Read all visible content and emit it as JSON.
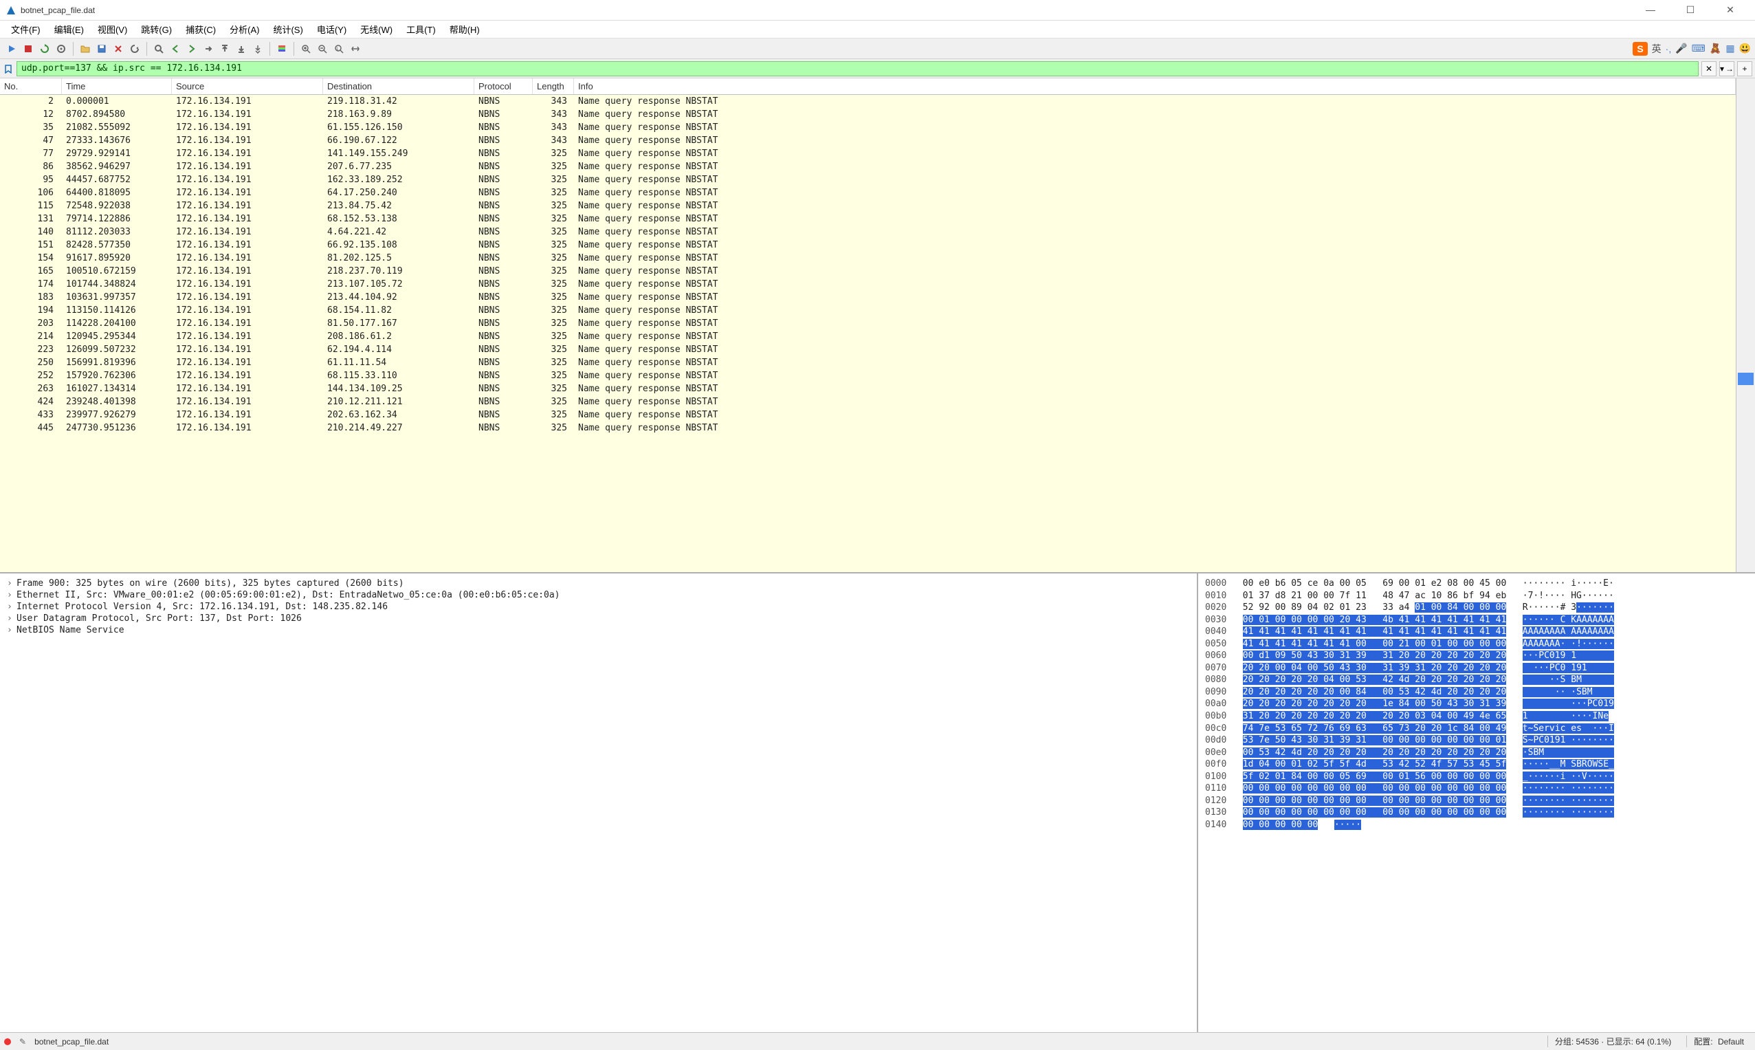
{
  "window": {
    "title": "botnet_pcap_file.dat",
    "min": "—",
    "max": "☐",
    "close": "✕"
  },
  "menu": {
    "file": "文件(F)",
    "edit": "编辑(E)",
    "view": "视图(V)",
    "go": "跳转(G)",
    "capture": "捕获(C)",
    "analyze": "分析(A)",
    "statistics": "统计(S)",
    "telephony": "电话(Y)",
    "wireless": "无线(W)",
    "tools": "工具(T)",
    "help": "帮助(H)"
  },
  "toolbar_icons": {
    "start": "▶",
    "stop": "■",
    "restart": "⟳",
    "options": "⚙",
    "open": "📂",
    "save": "💾",
    "close": "✖",
    "reload": "⟲",
    "find": "🔍",
    "back": "←",
    "fwd": "→",
    "jump": "↷",
    "goto_first": "⤒",
    "goto_last": "⤓",
    "auto_scroll": "⇊",
    "colorize": "🎨",
    "zoom_in": "🔍+",
    "zoom_out": "🔍−",
    "zoom_reset": "1:1",
    "resize_cols": "↔"
  },
  "ime": {
    "logo": "S",
    "lang": "英",
    "punct": "·,",
    "mic": "🎤",
    "keyboard": "⌨",
    "face": "😊",
    "user": "👤",
    "grid": "▦",
    "emoji": "😃"
  },
  "filter": {
    "value": "udp.port==137 && ip.src == 172.16.134.191",
    "clear_icon": "✕",
    "dropdown_icon": "▾",
    "apply_icon": "→",
    "plus_icon": "+"
  },
  "columns": {
    "no": "No.",
    "time": "Time",
    "src": "Source",
    "dst": "Destination",
    "proto": "Protocol",
    "len": "Length",
    "info": "Info"
  },
  "packets": [
    {
      "no": "2",
      "time": "0.000001",
      "src": "172.16.134.191",
      "dst": "219.118.31.42",
      "proto": "NBNS",
      "len": "343",
      "info": "Name query response NBSTAT"
    },
    {
      "no": "12",
      "time": "8702.894580",
      "src": "172.16.134.191",
      "dst": "218.163.9.89",
      "proto": "NBNS",
      "len": "343",
      "info": "Name query response NBSTAT"
    },
    {
      "no": "35",
      "time": "21082.555092",
      "src": "172.16.134.191",
      "dst": "61.155.126.150",
      "proto": "NBNS",
      "len": "343",
      "info": "Name query response NBSTAT"
    },
    {
      "no": "47",
      "time": "27333.143676",
      "src": "172.16.134.191",
      "dst": "66.190.67.122",
      "proto": "NBNS",
      "len": "343",
      "info": "Name query response NBSTAT"
    },
    {
      "no": "77",
      "time": "29729.929141",
      "src": "172.16.134.191",
      "dst": "141.149.155.249",
      "proto": "NBNS",
      "len": "325",
      "info": "Name query response NBSTAT"
    },
    {
      "no": "86",
      "time": "38562.946297",
      "src": "172.16.134.191",
      "dst": "207.6.77.235",
      "proto": "NBNS",
      "len": "325",
      "info": "Name query response NBSTAT"
    },
    {
      "no": "95",
      "time": "44457.687752",
      "src": "172.16.134.191",
      "dst": "162.33.189.252",
      "proto": "NBNS",
      "len": "325",
      "info": "Name query response NBSTAT"
    },
    {
      "no": "106",
      "time": "64400.818095",
      "src": "172.16.134.191",
      "dst": "64.17.250.240",
      "proto": "NBNS",
      "len": "325",
      "info": "Name query response NBSTAT"
    },
    {
      "no": "115",
      "time": "72548.922038",
      "src": "172.16.134.191",
      "dst": "213.84.75.42",
      "proto": "NBNS",
      "len": "325",
      "info": "Name query response NBSTAT"
    },
    {
      "no": "131",
      "time": "79714.122886",
      "src": "172.16.134.191",
      "dst": "68.152.53.138",
      "proto": "NBNS",
      "len": "325",
      "info": "Name query response NBSTAT"
    },
    {
      "no": "140",
      "time": "81112.203033",
      "src": "172.16.134.191",
      "dst": "4.64.221.42",
      "proto": "NBNS",
      "len": "325",
      "info": "Name query response NBSTAT"
    },
    {
      "no": "151",
      "time": "82428.577350",
      "src": "172.16.134.191",
      "dst": "66.92.135.108",
      "proto": "NBNS",
      "len": "325",
      "info": "Name query response NBSTAT"
    },
    {
      "no": "154",
      "time": "91617.895920",
      "src": "172.16.134.191",
      "dst": "81.202.125.5",
      "proto": "NBNS",
      "len": "325",
      "info": "Name query response NBSTAT"
    },
    {
      "no": "165",
      "time": "100510.672159",
      "src": "172.16.134.191",
      "dst": "218.237.70.119",
      "proto": "NBNS",
      "len": "325",
      "info": "Name query response NBSTAT"
    },
    {
      "no": "174",
      "time": "101744.348824",
      "src": "172.16.134.191",
      "dst": "213.107.105.72",
      "proto": "NBNS",
      "len": "325",
      "info": "Name query response NBSTAT"
    },
    {
      "no": "183",
      "time": "103631.997357",
      "src": "172.16.134.191",
      "dst": "213.44.104.92",
      "proto": "NBNS",
      "len": "325",
      "info": "Name query response NBSTAT"
    },
    {
      "no": "194",
      "time": "113150.114126",
      "src": "172.16.134.191",
      "dst": "68.154.11.82",
      "proto": "NBNS",
      "len": "325",
      "info": "Name query response NBSTAT"
    },
    {
      "no": "203",
      "time": "114228.204100",
      "src": "172.16.134.191",
      "dst": "81.50.177.167",
      "proto": "NBNS",
      "len": "325",
      "info": "Name query response NBSTAT"
    },
    {
      "no": "214",
      "time": "120945.295344",
      "src": "172.16.134.191",
      "dst": "208.186.61.2",
      "proto": "NBNS",
      "len": "325",
      "info": "Name query response NBSTAT"
    },
    {
      "no": "223",
      "time": "126099.507232",
      "src": "172.16.134.191",
      "dst": "62.194.4.114",
      "proto": "NBNS",
      "len": "325",
      "info": "Name query response NBSTAT"
    },
    {
      "no": "250",
      "time": "156991.819396",
      "src": "172.16.134.191",
      "dst": "61.11.11.54",
      "proto": "NBNS",
      "len": "325",
      "info": "Name query response NBSTAT"
    },
    {
      "no": "252",
      "time": "157920.762306",
      "src": "172.16.134.191",
      "dst": "68.115.33.110",
      "proto": "NBNS",
      "len": "325",
      "info": "Name query response NBSTAT"
    },
    {
      "no": "263",
      "time": "161027.134314",
      "src": "172.16.134.191",
      "dst": "144.134.109.25",
      "proto": "NBNS",
      "len": "325",
      "info": "Name query response NBSTAT"
    },
    {
      "no": "424",
      "time": "239248.401398",
      "src": "172.16.134.191",
      "dst": "210.12.211.121",
      "proto": "NBNS",
      "len": "325",
      "info": "Name query response NBSTAT"
    },
    {
      "no": "433",
      "time": "239977.926279",
      "src": "172.16.134.191",
      "dst": "202.63.162.34",
      "proto": "NBNS",
      "len": "325",
      "info": "Name query response NBSTAT"
    },
    {
      "no": "445",
      "time": "247730.951236",
      "src": "172.16.134.191",
      "dst": "210.214.49.227",
      "proto": "NBNS",
      "len": "325",
      "info": "Name query response NBSTAT"
    }
  ],
  "tree": [
    "Frame 900: 325 bytes on wire (2600 bits), 325 bytes captured (2600 bits)",
    "Ethernet II, Src: VMware_00:01:e2 (00:05:69:00:01:e2), Dst: EntradaNetwo_05:ce:0a (00:e0:b6:05:ce:0a)",
    "Internet Protocol Version 4, Src: 172.16.134.191, Dst: 148.235.82.146",
    "User Datagram Protocol, Src Port: 137, Dst Port: 1026",
    "NetBIOS Name Service"
  ],
  "hex": [
    {
      "off": "0000",
      "b1": "00 e0 b6 05 ce 0a 00 05",
      "b2": "69 00 01 e2 08 00 45 00",
      "a": "········ i·····E·",
      "sel": 0
    },
    {
      "off": "0010",
      "b1": "01 37 d8 21 00 00 7f 11",
      "b2": "48 47 ac 10 86 bf 94 eb",
      "a": "·7·!···· HG······",
      "sel": 0
    },
    {
      "off": "0020",
      "b1": "52 92 00 89 04 02 01 23",
      "b2": "33 a4 01 00 84 00 00 00",
      "a": "R······# 3·······",
      "sel": 2
    },
    {
      "off": "0030",
      "b1": "00 01 00 00 00 00 20 43",
      "b2": "4b 41 41 41 41 41 41 41",
      "a": "······ C KAAAAAAA",
      "sel": 1
    },
    {
      "off": "0040",
      "b1": "41 41 41 41 41 41 41 41",
      "b2": "41 41 41 41 41 41 41 41",
      "a": "AAAAAAAA AAAAAAAA",
      "sel": 1
    },
    {
      "off": "0050",
      "b1": "41 41 41 41 41 41 41 00",
      "b2": "00 21 00 01 00 00 00 00",
      "a": "AAAAAAA· ·!······",
      "sel": 1
    },
    {
      "off": "0060",
      "b1": "00 d1 09 50 43 30 31 39",
      "b2": "31 20 20 20 20 20 20 20",
      "a": "···PC019 1       ",
      "sel": 1
    },
    {
      "off": "0070",
      "b1": "20 20 00 04 00 50 43 30",
      "b2": "31 39 31 20 20 20 20 20",
      "a": "  ···PC0 191     ",
      "sel": 1
    },
    {
      "off": "0080",
      "b1": "20 20 20 20 20 04 00 53",
      "b2": "42 4d 20 20 20 20 20 20",
      "a": "     ··S BM      ",
      "sel": 1
    },
    {
      "off": "0090",
      "b1": "20 20 20 20 20 20 00 84",
      "b2": "00 53 42 4d 20 20 20 20",
      "a": "      ·· ·SBM    ",
      "sel": 1
    },
    {
      "off": "00a0",
      "b1": "20 20 20 20 20 20 20 20",
      "b2": "1e 84 00 50 43 30 31 39",
      "a": "         ···PC019",
      "sel": 1
    },
    {
      "off": "00b0",
      "b1": "31 20 20 20 20 20 20 20",
      "b2": "20 20 03 04 00 49 4e 65",
      "a": "1        ····INe",
      "sel": 1
    },
    {
      "off": "00c0",
      "b1": "74 7e 53 65 72 76 69 63",
      "b2": "65 73 20 20 1c 84 00 49",
      "a": "t~Servic es  ···I",
      "sel": 1
    },
    {
      "off": "00d0",
      "b1": "53 7e 50 43 30 31 39 31",
      "b2": "00 00 00 00 00 00 00 01",
      "a": "S~PC0191 ········",
      "sel": 1
    },
    {
      "off": "00e0",
      "b1": "00 53 42 4d 20 20 20 20",
      "b2": "20 20 20 20 20 20 20 20",
      "a": "·SBM             ",
      "sel": 1
    },
    {
      "off": "00f0",
      "b1": "1d 04 00 01 02 5f 5f 4d",
      "b2": "53 42 52 4f 57 53 45 5f",
      "a": "·····__M SBROWSE_",
      "sel": 1
    },
    {
      "off": "0100",
      "b1": "5f 02 01 84 00 00 05 69",
      "b2": "00 01 56 00 00 00 00 00",
      "a": "_······i ··V·····",
      "sel": 1
    },
    {
      "off": "0110",
      "b1": "00 00 00 00 00 00 00 00",
      "b2": "00 00 00 00 00 00 00 00",
      "a": "········ ········",
      "sel": 1
    },
    {
      "off": "0120",
      "b1": "00 00 00 00 00 00 00 00",
      "b2": "00 00 00 00 00 00 00 00",
      "a": "········ ········",
      "sel": 1
    },
    {
      "off": "0130",
      "b1": "00 00 00 00 00 00 00 00",
      "b2": "00 00 00 00 00 00 00 00",
      "a": "········ ········",
      "sel": 1
    },
    {
      "off": "0140",
      "b1": "00 00 00 00 00",
      "b2": "",
      "a": "·····",
      "sel": 3
    }
  ],
  "status": {
    "file": "botnet_pcap_file.dat",
    "packets": "分组: 54536 · 已显示: 64 (0.1%)",
    "profile_label": "配置:",
    "profile_value": "Default"
  }
}
